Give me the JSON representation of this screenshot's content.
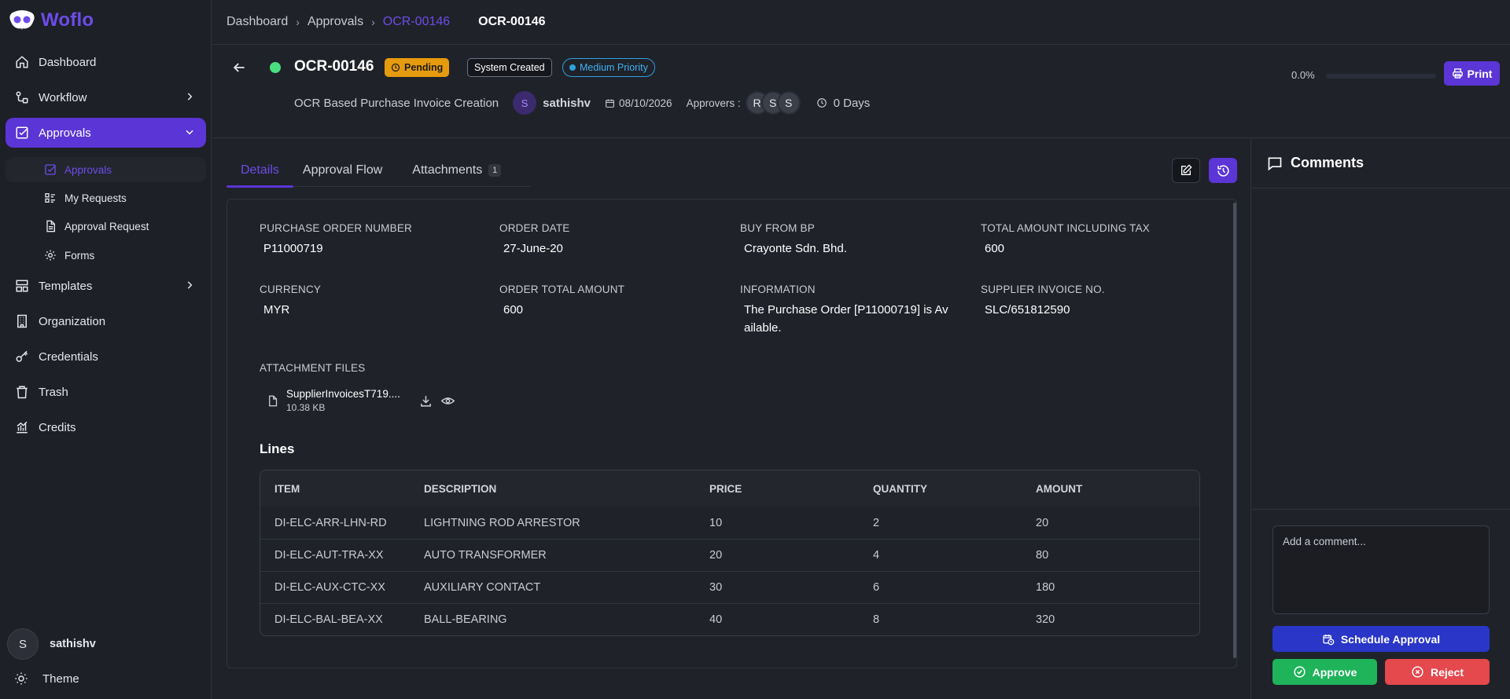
{
  "app": {
    "name": "Woflo"
  },
  "sidebar": {
    "items": [
      {
        "label": "Dashboard"
      },
      {
        "label": "Workflow"
      },
      {
        "label": "Approvals"
      },
      {
        "label": "Templates"
      },
      {
        "label": "Organization"
      },
      {
        "label": "Credentials"
      },
      {
        "label": "Trash"
      },
      {
        "label": "Credits"
      }
    ],
    "approvals_sub": [
      {
        "label": "Approvals"
      },
      {
        "label": "My Requests"
      },
      {
        "label": "Approval Request"
      },
      {
        "label": "Forms"
      }
    ],
    "user": {
      "initial": "S",
      "name": "sathishv"
    },
    "theme_label": "Theme"
  },
  "breadcrumb": {
    "items": [
      "Dashboard",
      "Approvals",
      "OCR-00146"
    ],
    "page_title": "OCR-00146"
  },
  "header": {
    "doc_id": "OCR-00146",
    "status_badge": "Pending",
    "source_badge": "System Created",
    "priority_badge": "Medium Priority",
    "workflow_name": "OCR Based Purchase Invoice Creation",
    "creator_initial": "S",
    "creator_name": "sathishv",
    "date": "08/10/2026",
    "approvers_label": "Approvers :",
    "approvers": [
      "R",
      "S",
      "S"
    ],
    "duration": "0 Days",
    "progress_text": "0.0%",
    "progress_value": 0,
    "print_label": "Print"
  },
  "tabs": [
    {
      "label": "Details"
    },
    {
      "label": "Approval Flow"
    },
    {
      "label": "Attachments",
      "count": "1"
    }
  ],
  "details": {
    "fields": [
      {
        "label": "PURCHASE ORDER NUMBER",
        "value": "P11000719"
      },
      {
        "label": "ORDER DATE",
        "value": "27-June-20"
      },
      {
        "label": "BUY FROM BP",
        "value": "Crayonte Sdn. Bhd."
      },
      {
        "label": "TOTAL AMOUNT INCLUDING TAX",
        "value": "600"
      },
      {
        "label": "CURRENCY",
        "value": "MYR"
      },
      {
        "label": "ORDER TOTAL AMOUNT",
        "value": "600"
      },
      {
        "label": "INFORMATION",
        "value": "The Purchase Order [P11000719] is Av ailable."
      },
      {
        "label": "SUPPLIER INVOICE NO.",
        "value": "SLC/651812590"
      }
    ],
    "attachments_label": "ATTACHMENT FILES",
    "file": {
      "name": "SupplierInvoicesT719....",
      "size": "10.38 KB"
    },
    "lines_title": "Lines",
    "table": {
      "headers": [
        "ITEM",
        "DESCRIPTION",
        "PRICE",
        "QUANTITY",
        "AMOUNT"
      ],
      "rows": [
        [
          "DI-ELC-ARR-LHN-RD",
          "LIGHTNING ROD ARRESTOR",
          "10",
          "2",
          "20"
        ],
        [
          "DI-ELC-AUT-TRA-XX",
          "AUTO TRANSFORMER",
          "20",
          "4",
          "80"
        ],
        [
          "DI-ELC-AUX-CTC-XX",
          "AUXILIARY CONTACT",
          "30",
          "6",
          "180"
        ],
        [
          "DI-ELC-BAL-BEA-XX",
          "BALL-BEARING",
          "40",
          "8",
          "320"
        ]
      ]
    }
  },
  "comments": {
    "title": "Comments",
    "placeholder": "Add a comment...",
    "schedule_label": "Schedule Approval",
    "approve_label": "Approve",
    "reject_label": "Reject"
  },
  "colors": {
    "accent": "#5b35d5",
    "pending": "#e69a0e",
    "priority": "#2ea0e0",
    "approve": "#1fb35a",
    "reject": "#e5484d",
    "schedule": "#2936c8"
  }
}
